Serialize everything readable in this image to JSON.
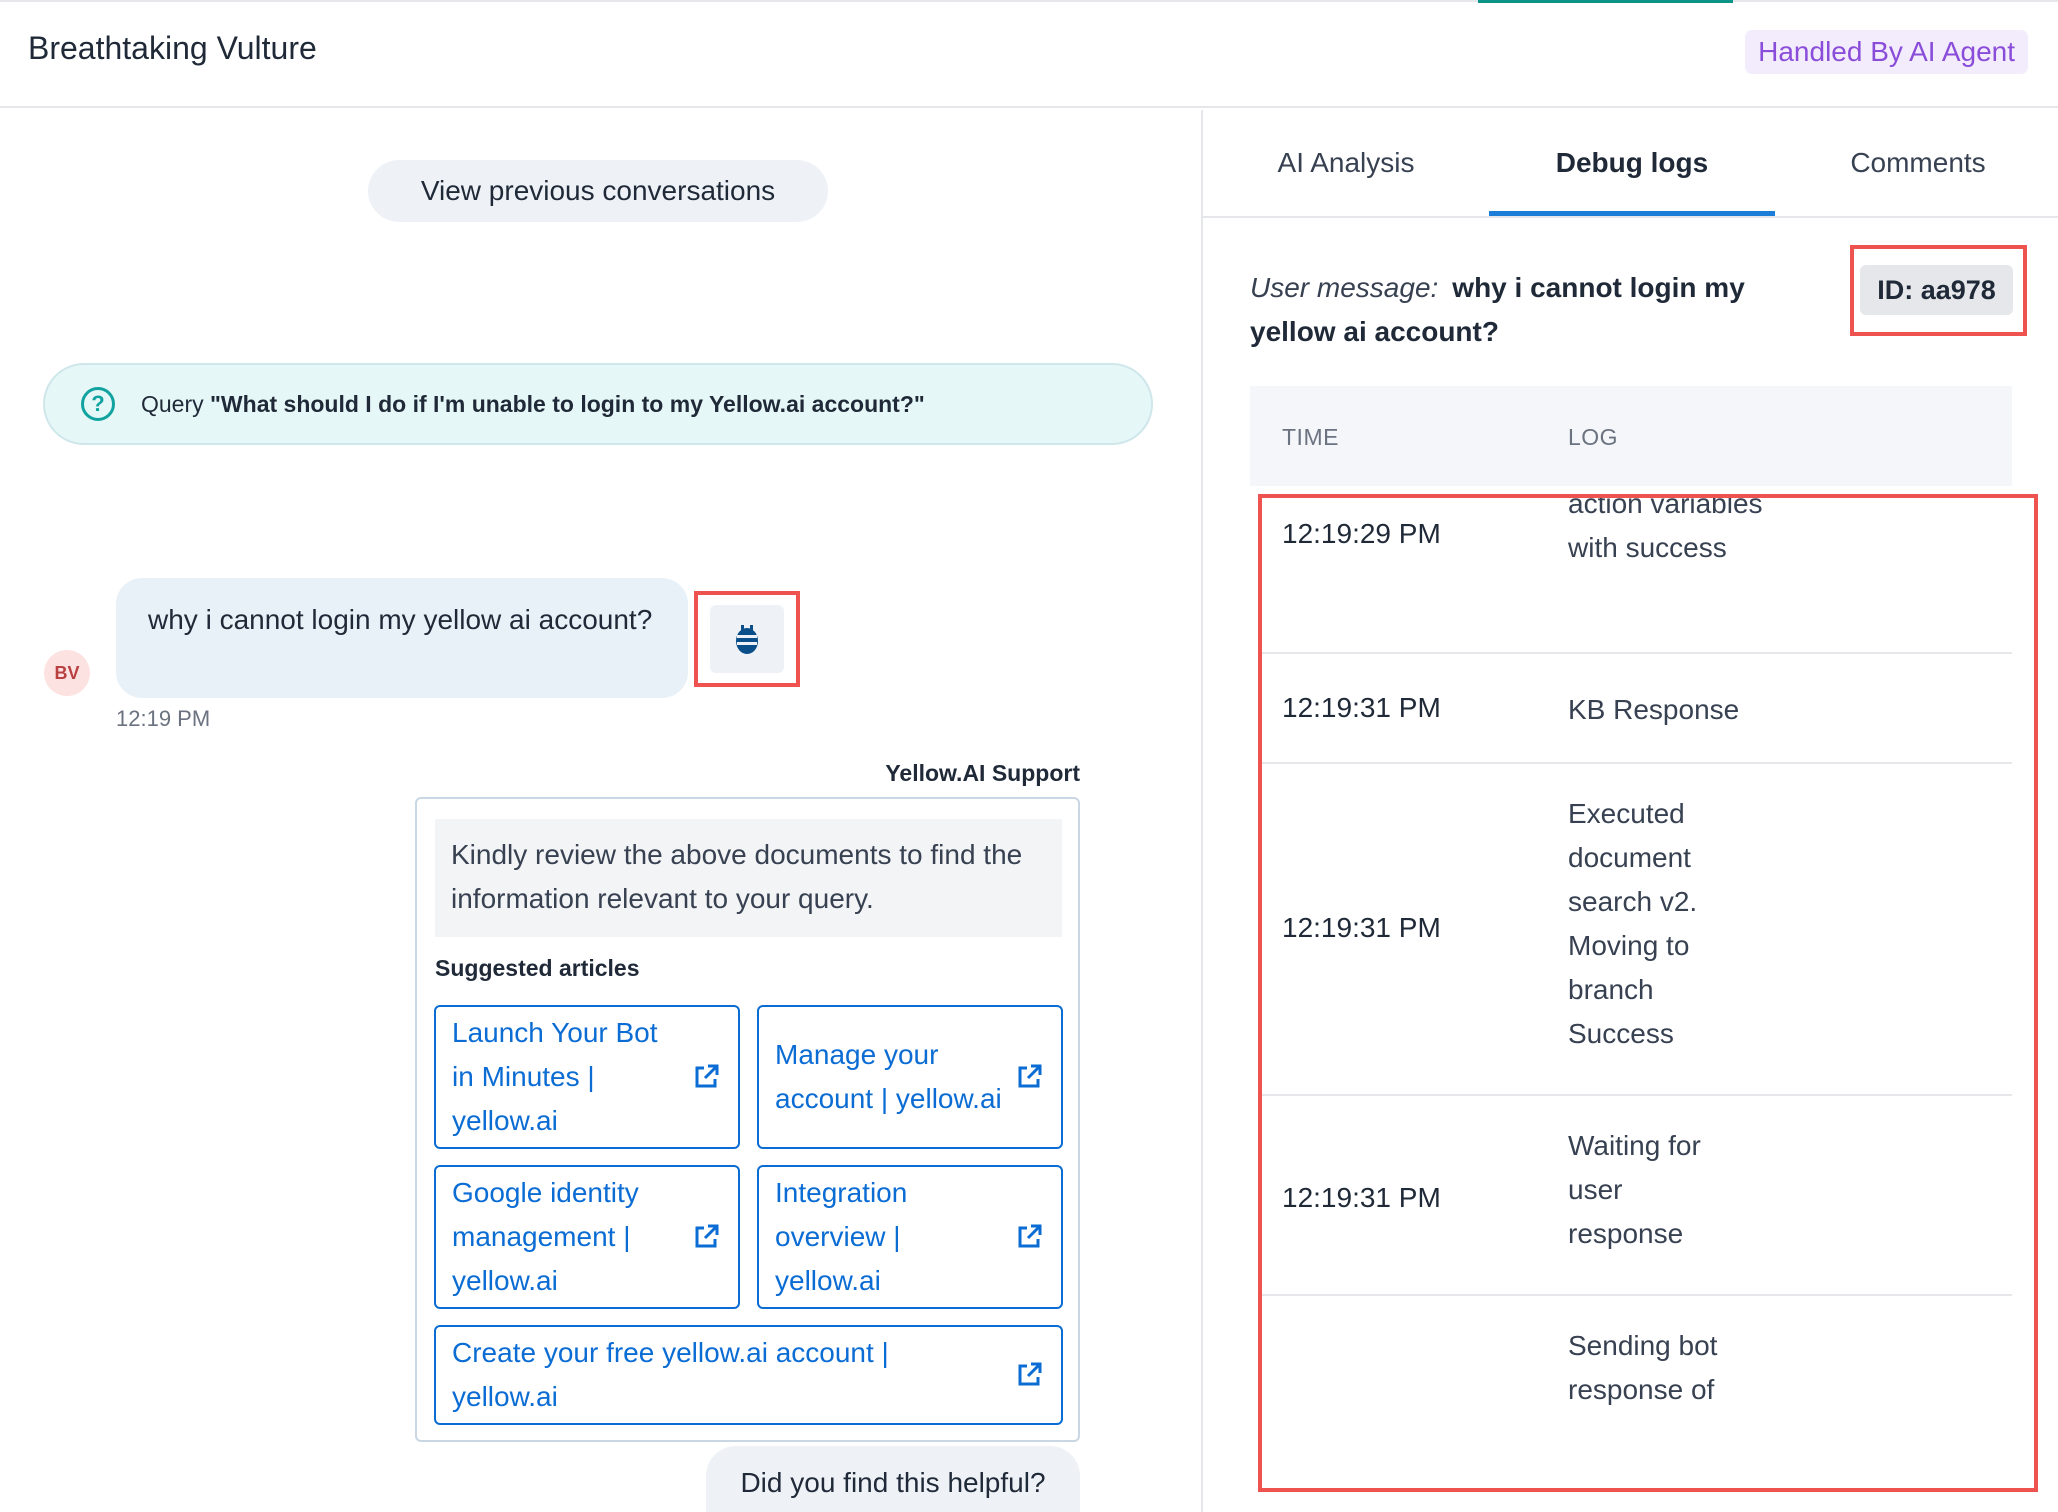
{
  "header": {
    "title": "Breathtaking Vulture",
    "status_badge": "Handled By AI Agent"
  },
  "conversation": {
    "view_previous_label": "View previous conversations",
    "query": {
      "prefix": "Query",
      "text": "\"What should I do if I'm unable to login to my Yellow.ai account?\""
    },
    "user": {
      "avatar_initials": "BV",
      "message": "why i cannot login my yellow ai account?",
      "time": "12:19 PM"
    },
    "bot": {
      "sender": "Yellow.AI Support",
      "message": "Kindly review the above documents to find the information relevant to your query.",
      "suggested_label": "Suggested articles",
      "articles": [
        "Launch Your Bot in Minutes | yellow.ai",
        "Manage your account | yellow.ai",
        "Google identity management | yellow.ai",
        "Integration overview | yellow.ai",
        "Create your free yellow.ai account | yellow.ai"
      ]
    },
    "feedback_prompt": "Did you find this helpful?"
  },
  "right_panel": {
    "tabs": [
      "AI Analysis",
      "Debug logs",
      "Comments"
    ],
    "active_tab": "Debug logs",
    "user_message_label": "User message:",
    "user_message": "why i cannot login my yellow ai account?",
    "id_label": "ID:  aa978",
    "log_columns": [
      "TIME",
      "LOG"
    ],
    "logs": [
      {
        "time": "12:19:29 PM",
        "log": "action variables with success"
      },
      {
        "time": "12:19:31 PM",
        "log": "KB Response"
      },
      {
        "time": "12:19:31 PM",
        "log": "Executed document search v2. Moving to branch Success"
      },
      {
        "time": "12:19:31 PM",
        "log": "Waiting for user response"
      },
      {
        "time": "",
        "log": "Sending bot response of"
      }
    ]
  },
  "colors": {
    "accent_blue": "#1c7ed6",
    "link_blue": "#0b6cd4",
    "badge_purple": "#8a4dd9",
    "highlight_red": "#ef5350",
    "query_teal": "#12a3a0"
  }
}
